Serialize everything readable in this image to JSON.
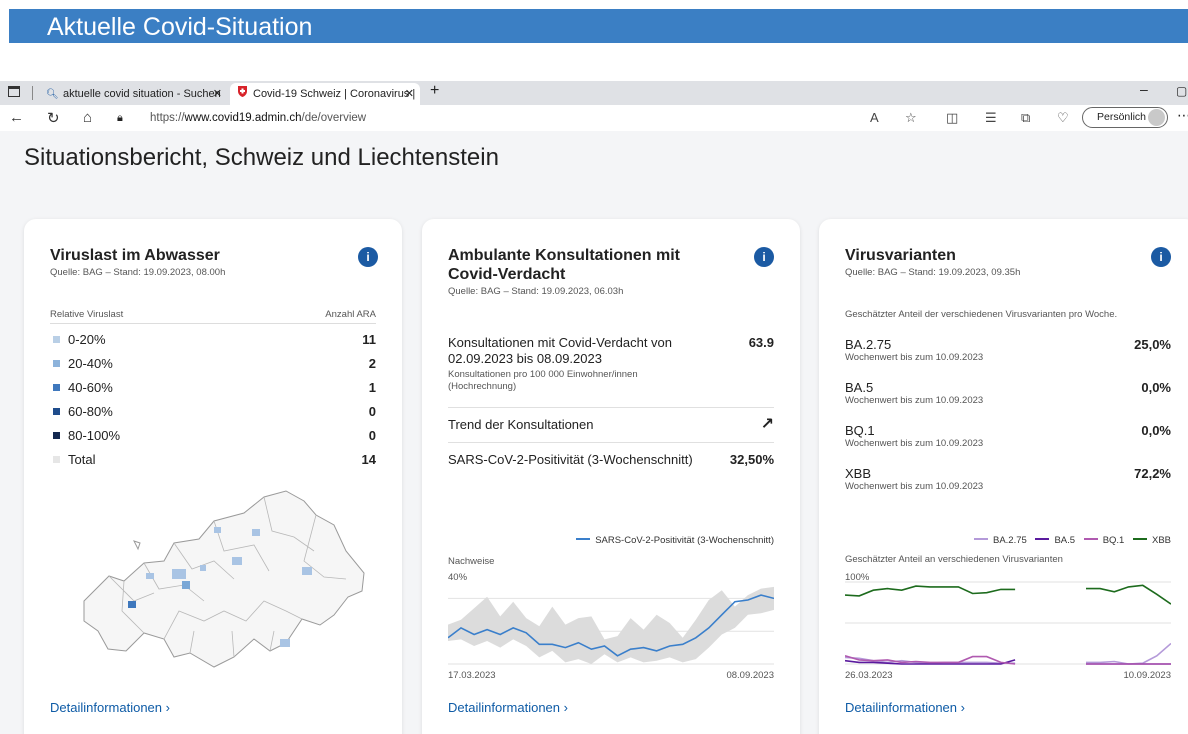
{
  "slide_title": "Aktuelle Covid-Situation",
  "browser": {
    "tabs": [
      {
        "label": "aktuelle covid situation - Suchen",
        "icon": "search-icon"
      },
      {
        "label": "Covid-19 Schweiz | Coronavirus |",
        "icon": "swiss-shield-icon"
      }
    ],
    "url_prefix": "https://",
    "url_domain": "www.covid19.admin.ch",
    "url_path": "/de/overview",
    "profile_label": "Persönlich"
  },
  "page_title": "Situationsbericht, Schweiz und Liechtenstein",
  "cards": {
    "wastewater": {
      "title": "Viruslast im Abwasser",
      "source": "Quelle: BAG – Stand: 19.09.2023, 08.00h",
      "col_left": "Relative Viruslast",
      "col_right": "Anzahl ARA",
      "rows": [
        {
          "label": "0-20%",
          "value": "11",
          "color": "#b9cfe6"
        },
        {
          "label": "20-40%",
          "value": "2",
          "color": "#8db3db"
        },
        {
          "label": "40-60%",
          "value": "1",
          "color": "#3f78bd"
        },
        {
          "label": "60-80%",
          "value": "0",
          "color": "#1f4c8c"
        },
        {
          "label": "80-100%",
          "value": "0",
          "color": "#13284f"
        },
        {
          "label": "Total",
          "value": "14",
          "color": "#e6e6e6"
        }
      ],
      "detail_link": "Detailinformationen"
    },
    "consultations": {
      "title": "Ambulante Konsultationen mit Covid-Verdacht",
      "source": "Quelle: BAG – Stand: 19.09.2023, 06.03h",
      "consult_label": "Konsultationen mit Covid-Verdacht von 02.09.2023 bis 08.09.2023",
      "consult_sub": "Konsultationen pro 100 000 Einwohner/innen (Hochrechnung)",
      "consult_value": "63.9",
      "trend_label": "Trend der Konsultationen",
      "positivity_label": "SARS-CoV-2-Positivität (3-Wochenschnitt)",
      "positivity_value": "32,50%",
      "chart_legend": "SARS-CoV-2-Positivität (3-Wochenschnitt)",
      "chart_ylabel": "Nachweise",
      "chart_ytick": "40%",
      "chart_xstart": "17.03.2023",
      "chart_xend": "08.09.2023",
      "detail_link": "Detailinformationen"
    },
    "variants": {
      "title": "Virusvarianten",
      "source": "Quelle: BAG – Stand: 19.09.2023, 09.35h",
      "desc": "Geschätzter Anteil der verschiedenen Virusvarianten pro Woche.",
      "rows": [
        {
          "name": "BA.2.75",
          "sub": "Wochenwert bis zum 10.09.2023",
          "value": "25,0%"
        },
        {
          "name": "BA.5",
          "sub": "Wochenwert bis zum 10.09.2023",
          "value": "0,0%"
        },
        {
          "name": "BQ.1",
          "sub": "Wochenwert bis zum 10.09.2023",
          "value": "0,0%"
        },
        {
          "name": "XBB",
          "sub": "Wochenwert bis zum 10.09.2023",
          "value": "72,2%"
        }
      ],
      "legend": [
        {
          "name": "BA.2.75",
          "color": "#b49ad9"
        },
        {
          "name": "BA.5",
          "color": "#5a1a9e"
        },
        {
          "name": "BQ.1",
          "color": "#b05ab0"
        },
        {
          "name": "XBB",
          "color": "#1d6b1d"
        }
      ],
      "chart_title": "Geschätzter Anteil an verschiedenen Virusvarianten",
      "chart_ytick": "100%",
      "chart_xstart": "26.03.2023",
      "chart_xend": "10.09.2023",
      "detail_link": "Detailinformationen"
    }
  },
  "chart_data": [
    {
      "type": "line",
      "ylabel": "Nachweise",
      "ylim": [
        0,
        50
      ],
      "x_range": [
        "17.03.2023",
        "08.09.2023"
      ],
      "series": [
        {
          "name": "SARS-CoV-2-Positivität (3-Wochenschnitt)",
          "color": "#3a7fcb",
          "values": [
            16,
            22,
            18,
            21,
            18,
            22,
            19,
            12,
            12,
            10,
            13,
            9,
            11,
            5,
            9,
            10,
            8,
            11,
            12,
            16,
            22,
            30,
            38,
            39,
            42,
            40
          ]
        }
      ],
      "band_upper": [
        24,
        27,
        34,
        41,
        29,
        38,
        28,
        23,
        35,
        24,
        28,
        29,
        15,
        17,
        28,
        21,
        30,
        25,
        16,
        27,
        39,
        45,
        35,
        42,
        46,
        47
      ],
      "band_lower": [
        14,
        15,
        11,
        14,
        10,
        15,
        11,
        4,
        8,
        1,
        3,
        0,
        6,
        1,
        4,
        1,
        2,
        4,
        1,
        3,
        10,
        18,
        22,
        30,
        31,
        33
      ]
    },
    {
      "type": "line",
      "ylim": [
        0,
        100
      ],
      "x_range": [
        "26.03.2023",
        "10.09.2023"
      ],
      "series": [
        {
          "name": "XBB",
          "color": "#1d6b1d",
          "values": [
            84,
            83,
            90,
            92,
            90,
            95,
            94,
            94,
            94,
            86,
            87,
            91,
            91,
            null,
            null,
            null,
            null,
            92,
            92,
            88,
            94,
            96,
            85,
            73
          ]
        },
        {
          "name": "BA.2.75",
          "color": "#b49ad9",
          "values": [
            8,
            7,
            4,
            2,
            4,
            2,
            1,
            2,
            2,
            2,
            2,
            1,
            1,
            null,
            null,
            null,
            null,
            2,
            2,
            3,
            0,
            1,
            10,
            25
          ]
        },
        {
          "name": "BA.5",
          "color": "#5a1a9e",
          "values": [
            4,
            2,
            2,
            1,
            0,
            0,
            0,
            0,
            0,
            0,
            0,
            0,
            5,
            null,
            null,
            null,
            null,
            0,
            0,
            0,
            0,
            0,
            0,
            0
          ]
        },
        {
          "name": "BQ.1",
          "color": "#b05ab0",
          "values": [
            10,
            5,
            4,
            5,
            2,
            3,
            2,
            2,
            2,
            9,
            9,
            2,
            0,
            null,
            null,
            null,
            null,
            0,
            0,
            0,
            0,
            0,
            0,
            0
          ]
        }
      ]
    }
  ]
}
